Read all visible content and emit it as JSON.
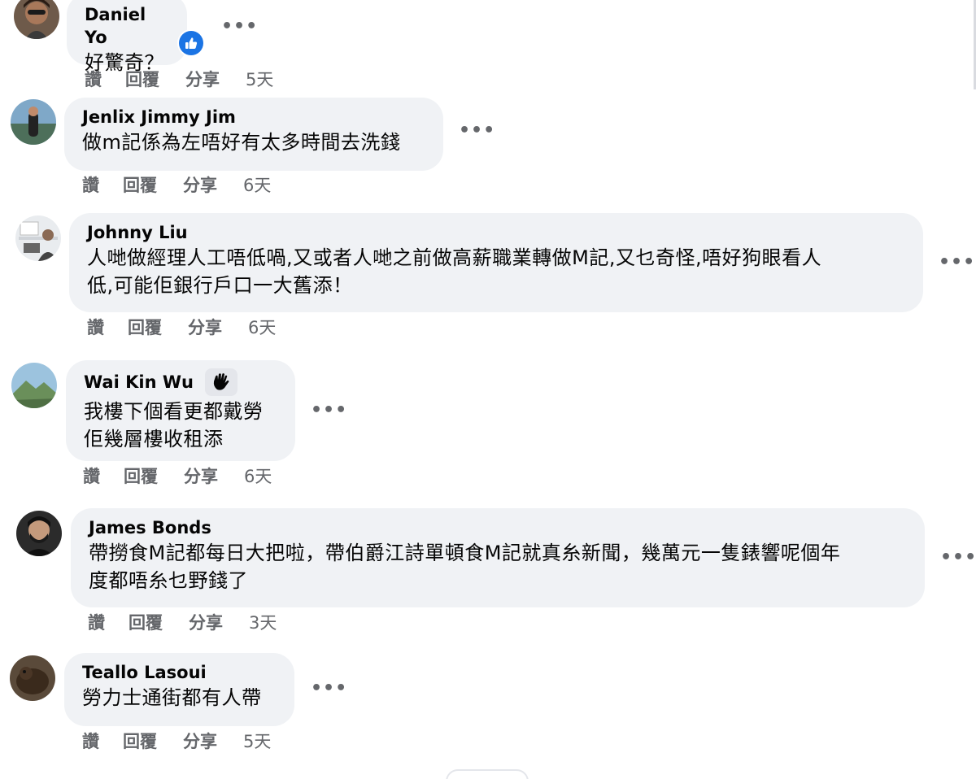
{
  "actions": {
    "like": "讚",
    "reply": "回覆",
    "share": "分享"
  },
  "more_label": "•••",
  "comments": [
    {
      "author": "Daniel Yo",
      "text": "好驚奇？",
      "time": "5天",
      "reaction": "like",
      "avatar": "portrait"
    },
    {
      "author": "Jenlix Jimmy Jim",
      "text": "做m記係為左唔好有太多時間去洗錢",
      "time": "6天",
      "avatar": "landscape-person"
    },
    {
      "author": "Johnny Liu",
      "text": "人哋做經理人工唔低喎,又或者人哋之前做高薪職業轉做M記,又乜奇怪,唔好狗眼看人\n低,可能佢銀行戶口一大舊添！",
      "time": "6天",
      "avatar": "office-person"
    },
    {
      "author": "Wai Kin Wu",
      "text": "我樓下個看更都戴勞\n佢幾層樓收租添",
      "time": "6天",
      "badge": "waving-hand-icon",
      "avatar": "mountain"
    },
    {
      "author": "James Bonds",
      "text": "帶撈食M記都每日大把啦，帶伯爵江詩單頓食M記就真糸新聞，幾萬元一隻錶響呢個年\n度都唔糸乜野錢了",
      "time": "3天",
      "avatar": "bearded-man"
    },
    {
      "author": "Teallo Lasoui",
      "text": "勞力士通街都有人帶",
      "time": "5天",
      "avatar": "animal"
    }
  ],
  "colors": {
    "bubble": "#f0f2f5",
    "secondary_text": "#65676b",
    "like_blue": "#1b74e4"
  }
}
